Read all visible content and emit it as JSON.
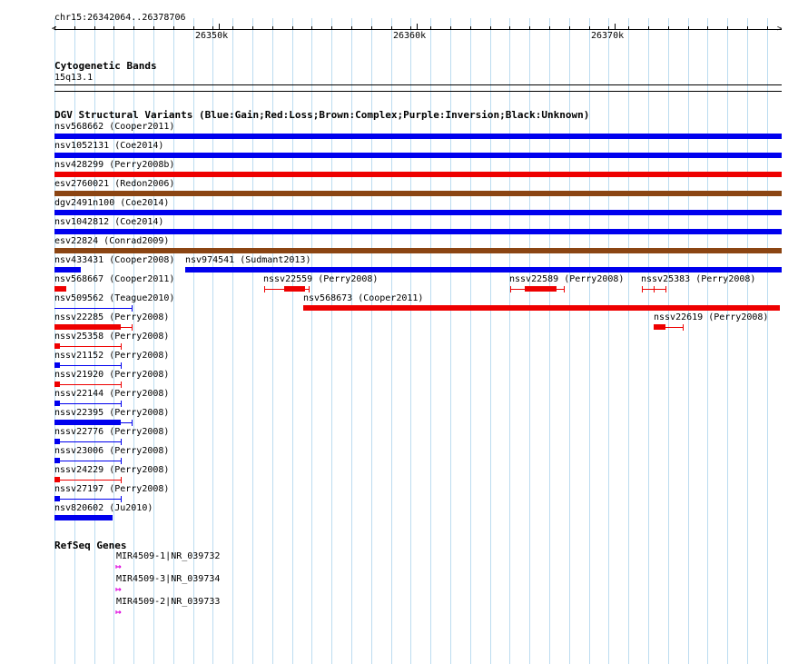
{
  "ruler": {
    "location": "chr15:26342064..26378706",
    "labels": [
      "26350k",
      "26360k",
      "26370k"
    ]
  },
  "cyto": {
    "title": "Cytogenetic Bands",
    "band": "15q13.1"
  },
  "dgv": {
    "title": "DGV Structural Variants (Blue:Gain;Red:Loss;Brown:Complex;Purple:Inversion;Black:Unknown)",
    "colors": {
      "gain": "#0000ee",
      "loss": "#ee0000",
      "complex": "#8b4513"
    },
    "variants": [
      {
        "label": "nsv568662 (Cooper2011)",
        "type": "gain",
        "full": true
      },
      {
        "label": "nsv1052131 (Coe2014)",
        "type": "gain",
        "full": true
      },
      {
        "label": "nsv428299 (Perry2008b)",
        "type": "loss",
        "full": true
      },
      {
        "label": "esv2760021 (Redon2006)",
        "type": "complex",
        "full": true
      },
      {
        "label": "dgv2491n100 (Coe2014)",
        "type": "gain",
        "full": true
      },
      {
        "label": "nsv1042812 (Coe2014)",
        "type": "gain",
        "full": true
      },
      {
        "label": "esv22824 (Conrad2009)",
        "type": "complex",
        "full": true
      },
      {
        "label": "nsv433431 (Cooper2008)",
        "type": "gain"
      },
      {
        "label": "nsv974541 (Sudmant2013)",
        "type": "gain"
      },
      {
        "label": "nsv568667 (Cooper2011)",
        "type": "loss"
      },
      {
        "label": "nssv22559 (Perry2008)",
        "type": "loss"
      },
      {
        "label": "nssv22589 (Perry2008)",
        "type": "loss"
      },
      {
        "label": "nssv25383 (Perry2008)",
        "type": "loss"
      },
      {
        "label": "nsv509562 (Teague2010)",
        "type": "gain"
      },
      {
        "label": "nsv568673 (Cooper2011)",
        "type": "loss"
      },
      {
        "label": "nssv22285 (Perry2008)",
        "type": "loss"
      },
      {
        "label": "nssv22619 (Perry2008)",
        "type": "loss"
      },
      {
        "label": "nssv25358 (Perry2008)",
        "type": "loss"
      },
      {
        "label": "nssv21152 (Perry2008)",
        "type": "gain"
      },
      {
        "label": "nssv21920 (Perry2008)",
        "type": "loss"
      },
      {
        "label": "nssv22144 (Perry2008)",
        "type": "gain"
      },
      {
        "label": "nssv22395 (Perry2008)",
        "type": "gain"
      },
      {
        "label": "nssv22776 (Perry2008)",
        "type": "gain"
      },
      {
        "label": "nssv23006 (Perry2008)",
        "type": "gain"
      },
      {
        "label": "nssv24229 (Perry2008)",
        "type": "loss"
      },
      {
        "label": "nssv27197 (Perry2008)",
        "type": "gain"
      },
      {
        "label": "nsv820602 (Ju2010)",
        "type": "gain"
      }
    ]
  },
  "refseq": {
    "title": "RefSeq Genes",
    "color": "#dd00dd",
    "genes": [
      {
        "label": "MIR4509-1|NR_039732"
      },
      {
        "label": "MIR4509-3|NR_039734"
      },
      {
        "label": "MIR4509-2|NR_039733"
      }
    ]
  }
}
